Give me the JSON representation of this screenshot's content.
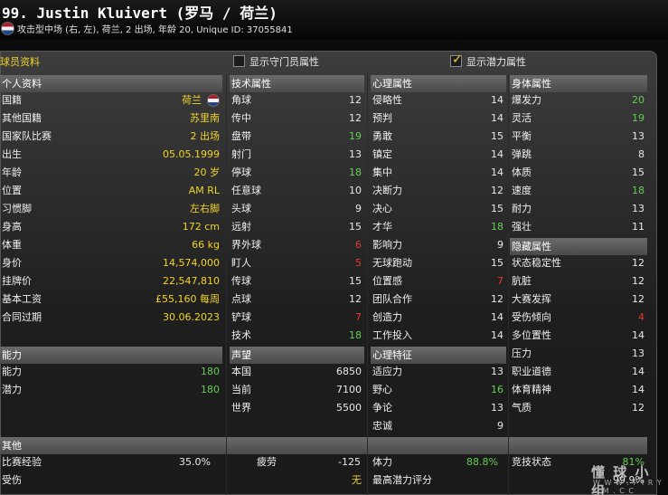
{
  "header": {
    "title": "99. Justin Kluivert (罗马 / 荷兰)",
    "subtitle": "攻击型中场 (右, 左), 荷兰, 2 出场, 年龄 20, Unique ID: 37055841",
    "flag_icon": "netherlands-flag-icon"
  },
  "toolbar": {
    "profile_label": "球员资料",
    "gk_attrs_label": "显示守门员属性",
    "gk_attrs_checked": false,
    "potential_label": "显示潜力属性",
    "potential_checked": true
  },
  "personal": {
    "heading": "个人资料",
    "rows": [
      {
        "k": "国籍",
        "v": "荷兰"
      },
      {
        "k": "其他国籍",
        "v": "苏里南"
      },
      {
        "k": "国家队比赛",
        "v": "2 出场"
      },
      {
        "k": "出生",
        "v": "05.05.1999"
      },
      {
        "k": "年龄",
        "v": "20 岁"
      },
      {
        "k": "位置",
        "v": "AM RL"
      },
      {
        "k": "习惯脚",
        "v": "左右脚"
      },
      {
        "k": "身高",
        "v": "172 cm"
      },
      {
        "k": "体重",
        "v": "66 kg"
      },
      {
        "k": "身价",
        "v": "14,574,000"
      },
      {
        "k": "挂牌价",
        "v": "22,547,810"
      },
      {
        "k": "基本工资",
        "v": "£55,160 每周"
      },
      {
        "k": "合同过期",
        "v": "30.06.2023"
      }
    ]
  },
  "ability": {
    "heading": "能力",
    "rows": [
      {
        "k": "能力",
        "v": "180"
      },
      {
        "k": "潜力",
        "v": "180"
      }
    ]
  },
  "other": {
    "heading": "其他",
    "rows": [
      {
        "k": "比赛经验",
        "v": "35.0%"
      },
      {
        "k": "受伤",
        "v": ""
      }
    ],
    "fatigue": {
      "k": "疲劳",
      "v": "-125"
    },
    "none": {
      "k": "",
      "v": "无"
    },
    "stamina": {
      "k": "体力",
      "v": "88.8%"
    },
    "max_potential": {
      "k": "最高潜力评分",
      "v": ""
    },
    "condition": {
      "k": "竞技状态",
      "v": "81%"
    },
    "rating": {
      "k": "",
      "v": "99.9%"
    }
  },
  "technical": {
    "heading": "技术属性",
    "rows": [
      {
        "k": "角球",
        "v": "12"
      },
      {
        "k": "传中",
        "v": "12"
      },
      {
        "k": "盘带",
        "v": "19"
      },
      {
        "k": "射门",
        "v": "13"
      },
      {
        "k": "停球",
        "v": "18"
      },
      {
        "k": "任意球",
        "v": "10"
      },
      {
        "k": "头球",
        "v": "9"
      },
      {
        "k": "远射",
        "v": "15"
      },
      {
        "k": "界外球",
        "v": "6"
      },
      {
        "k": "盯人",
        "v": "5"
      },
      {
        "k": "传球",
        "v": "15"
      },
      {
        "k": "点球",
        "v": "12"
      },
      {
        "k": "铲球",
        "v": "7"
      },
      {
        "k": "技术",
        "v": "18"
      }
    ]
  },
  "reputation": {
    "heading": "声望",
    "rows": [
      {
        "k": "本国",
        "v": "6850"
      },
      {
        "k": "当前",
        "v": "7100"
      },
      {
        "k": "世界",
        "v": "5500"
      }
    ]
  },
  "mental": {
    "heading": "心理属性",
    "rows": [
      {
        "k": "侵略性",
        "v": "14"
      },
      {
        "k": "预判",
        "v": "14"
      },
      {
        "k": "勇敢",
        "v": "15"
      },
      {
        "k": "镇定",
        "v": "14"
      },
      {
        "k": "集中",
        "v": "14"
      },
      {
        "k": "决断力",
        "v": "12"
      },
      {
        "k": "决心",
        "v": "15"
      },
      {
        "k": "才华",
        "v": "18"
      },
      {
        "k": "影响力",
        "v": "9"
      },
      {
        "k": "无球跑动",
        "v": "15"
      },
      {
        "k": "位置感",
        "v": "7"
      },
      {
        "k": "团队合作",
        "v": "12"
      },
      {
        "k": "创造力",
        "v": "14"
      },
      {
        "k": "工作投入",
        "v": "14"
      }
    ]
  },
  "traits": {
    "heading": "心理特征",
    "rows": [
      {
        "k": "适应力",
        "v": "13"
      },
      {
        "k": "野心",
        "v": "16"
      },
      {
        "k": "争论",
        "v": "13"
      },
      {
        "k": "忠诚",
        "v": "9"
      }
    ]
  },
  "physical": {
    "heading": "身体属性",
    "rows": [
      {
        "k": "爆发力",
        "v": "20"
      },
      {
        "k": "灵活",
        "v": "19"
      },
      {
        "k": "平衡",
        "v": "13"
      },
      {
        "k": "弹跳",
        "v": "8"
      },
      {
        "k": "体质",
        "v": "15"
      },
      {
        "k": "速度",
        "v": "18"
      },
      {
        "k": "耐力",
        "v": "13"
      },
      {
        "k": "强壮",
        "v": "11"
      }
    ]
  },
  "hidden": {
    "heading": "隐藏属性",
    "rows": [
      {
        "k": "状态稳定性",
        "v": "12"
      },
      {
        "k": "肮脏",
        "v": "12"
      },
      {
        "k": "大赛发挥",
        "v": "12"
      },
      {
        "k": "受伤倾向",
        "v": "4"
      },
      {
        "k": "多位置性",
        "v": "14"
      },
      {
        "k": "压力",
        "v": "13"
      },
      {
        "k": "职业道德",
        "v": "14"
      },
      {
        "k": "体育精神",
        "v": "14"
      },
      {
        "k": "气质",
        "v": "12"
      }
    ]
  },
  "watermark": {
    "text": "懂 球 小 组",
    "url": "W W W . P I R Y G M . C C"
  }
}
